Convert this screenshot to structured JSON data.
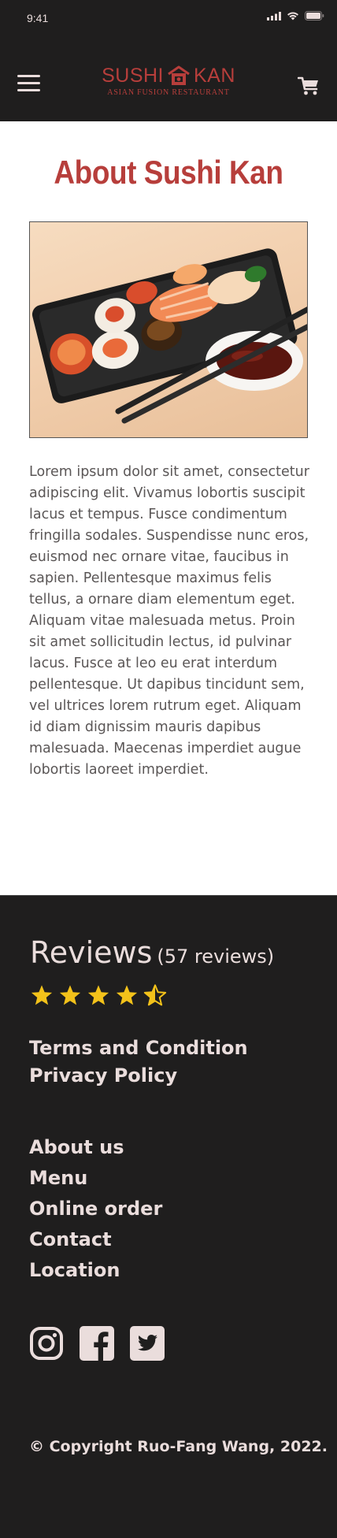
{
  "status": {
    "time": "9:41",
    "icons": [
      "signal-icon",
      "wifi-icon",
      "battery-icon"
    ]
  },
  "header": {
    "menu_icon": "hamburger-icon",
    "logo": {
      "main_left": "SUSHI",
      "main_right": "KAN",
      "sub": "ASIAN FUSION RESTAURANT"
    },
    "cart_icon": "cart-icon"
  },
  "about": {
    "title": "About Sushi Kan",
    "image": "sushi-tray-image",
    "text": "Lorem ipsum dolor sit amet, consectetur adipiscing elit. Vivamus lobortis suscipit lacus et tempus. Fusce condimentum fringilla sodales. Suspendisse nunc eros, euismod nec ornare vitae, faucibus in sapien. Pellentesque maximus felis tellus, a ornare diam elementum eget. Aliquam vitae malesuada metus. Proin sit amet sollicitudin lectus, id pulvinar lacus. Fusce at leo eu erat interdum pellentesque. Ut dapibus tincidunt sem, vel ultrices lorem rutrum eget. Aliquam id diam dignissim mauris dapibus malesuada. Maecenas imperdiet augue lobortis laoreet imperdiet."
  },
  "footer": {
    "reviews_title": "Reviews",
    "reviews_count": "(57 reviews)",
    "rating": 4.5,
    "rating_max": 5,
    "star_color": "#f3c21a",
    "legal_links": [
      "Terms and Condition",
      "Privacy Policy"
    ],
    "nav_links": [
      "About us",
      "Menu",
      "Online order",
      "Contact",
      "Location"
    ],
    "social": [
      "instagram-icon",
      "facebook-icon",
      "twitter-icon"
    ],
    "copyright": "© Copyright Ruo-Fang Wang, 2022."
  },
  "colors": {
    "dark_bg": "#1f1e1e",
    "brand_red": "#b73e3b",
    "light_text": "#eadddc",
    "body_text": "#5a5656"
  }
}
